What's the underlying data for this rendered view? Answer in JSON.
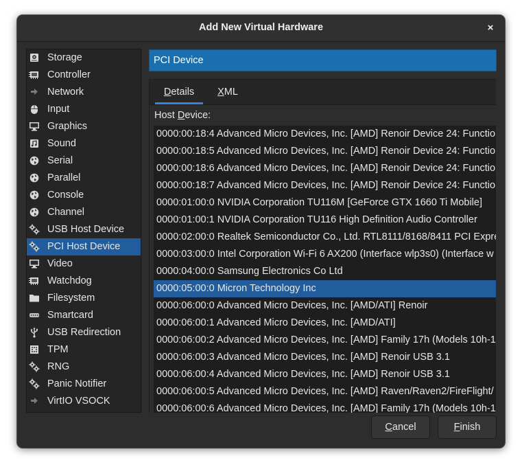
{
  "window": {
    "title": "Add New Virtual Hardware",
    "close_glyph": "×"
  },
  "sidebar": {
    "items": [
      {
        "label": "Storage",
        "icon": "storage-icon",
        "selected": false
      },
      {
        "label": "Controller",
        "icon": "controller-chip-icon",
        "selected": false
      },
      {
        "label": "Network",
        "icon": "network-icon",
        "selected": false
      },
      {
        "label": "Input",
        "icon": "mouse-icon",
        "selected": false
      },
      {
        "label": "Graphics",
        "icon": "monitor-icon",
        "selected": false
      },
      {
        "label": "Sound",
        "icon": "sound-card-icon",
        "selected": false
      },
      {
        "label": "Serial",
        "icon": "globe-icon",
        "selected": false
      },
      {
        "label": "Parallel",
        "icon": "globe-icon",
        "selected": false
      },
      {
        "label": "Console",
        "icon": "globe-icon",
        "selected": false
      },
      {
        "label": "Channel",
        "icon": "globe-icon",
        "selected": false
      },
      {
        "label": "USB Host Device",
        "icon": "gears-icon",
        "selected": false
      },
      {
        "label": "PCI Host Device",
        "icon": "gears-icon",
        "selected": true
      },
      {
        "label": "Video",
        "icon": "monitor-icon",
        "selected": false
      },
      {
        "label": "Watchdog",
        "icon": "watchdog-chip-icon",
        "selected": false
      },
      {
        "label": "Filesystem",
        "icon": "folder-icon",
        "selected": false
      },
      {
        "label": "Smartcard",
        "icon": "smartcard-icon",
        "selected": false
      },
      {
        "label": "USB Redirection",
        "icon": "usb-icon",
        "selected": false
      },
      {
        "label": "TPM",
        "icon": "tpm-chip-icon",
        "selected": false
      },
      {
        "label": "RNG",
        "icon": "gears-icon",
        "selected": false
      },
      {
        "label": "Panic Notifier",
        "icon": "gears-icon",
        "selected": false
      },
      {
        "label": "VirtIO VSOCK",
        "icon": "network-icon",
        "selected": false
      }
    ]
  },
  "header": {
    "title": "PCI Device"
  },
  "tabs": [
    {
      "label": "Details",
      "active": true
    },
    {
      "label": "XML",
      "active": false
    }
  ],
  "host_device": {
    "label": "Host Device:",
    "rows": [
      {
        "text": "0000:00:18:4 Advanced Micro Devices, Inc. [AMD] Renoir Device 24: Functio",
        "selected": false
      },
      {
        "text": "0000:00:18:5 Advanced Micro Devices, Inc. [AMD] Renoir Device 24: Functio",
        "selected": false
      },
      {
        "text": "0000:00:18:6 Advanced Micro Devices, Inc. [AMD] Renoir Device 24: Functio",
        "selected": false
      },
      {
        "text": "0000:00:18:7 Advanced Micro Devices, Inc. [AMD] Renoir Device 24: Functio",
        "selected": false
      },
      {
        "text": "0000:01:00:0 NVIDIA Corporation TU116M [GeForce GTX 1660 Ti Mobile]",
        "selected": false
      },
      {
        "text": "0000:01:00:1 NVIDIA Corporation TU116 High Definition Audio Controller",
        "selected": false
      },
      {
        "text": "0000:02:00:0 Realtek Semiconductor Co., Ltd. RTL8111/8168/8411 PCI Expre",
        "selected": false
      },
      {
        "text": "0000:03:00:0 Intel Corporation Wi-Fi 6 AX200 (Interface wlp3s0) (Interface w",
        "selected": false
      },
      {
        "text": "0000:04:00:0 Samsung Electronics Co Ltd",
        "selected": false
      },
      {
        "text": "0000:05:00:0 Micron Technology Inc",
        "selected": true
      },
      {
        "text": "0000:06:00:0 Advanced Micro Devices, Inc. [AMD/ATI] Renoir",
        "selected": false
      },
      {
        "text": "0000:06:00:1 Advanced Micro Devices, Inc. [AMD/ATI]",
        "selected": false
      },
      {
        "text": "0000:06:00:2 Advanced Micro Devices, Inc. [AMD] Family 17h (Models 10h-1",
        "selected": false
      },
      {
        "text": "0000:06:00:3 Advanced Micro Devices, Inc. [AMD] Renoir USB 3.1",
        "selected": false
      },
      {
        "text": "0000:06:00:4 Advanced Micro Devices, Inc. [AMD] Renoir USB 3.1",
        "selected": false
      },
      {
        "text": "0000:06:00:5 Advanced Micro Devices, Inc. [AMD] Raven/Raven2/FireFlight/",
        "selected": false
      },
      {
        "text": "0000:06:00:6 Advanced Micro Devices, Inc. [AMD] Family 17h (Models 10h-1",
        "selected": false
      }
    ]
  },
  "buttons": {
    "cancel": "Cancel",
    "finish": "Finish"
  },
  "colors": {
    "selection": "#215d9c",
    "header_bar": "#1c6fae",
    "tab_indicator": "#3584e4"
  }
}
